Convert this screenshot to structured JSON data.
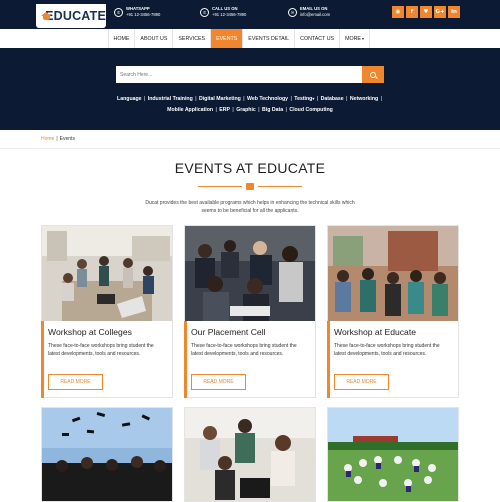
{
  "brand": {
    "name": "EDUCATE"
  },
  "contacts": [
    {
      "icon": "whatsapp-icon",
      "glyph": "✆",
      "label": "WHATSAPP",
      "value": "+91 12-3456-7890"
    },
    {
      "icon": "phone-icon",
      "glyph": "✆",
      "label": "CALL US ON",
      "value": "+91 12-3456-7890"
    },
    {
      "icon": "mail-icon",
      "glyph": "✉",
      "label": "EMAIL US ON",
      "value": "info@email.com"
    }
  ],
  "social": [
    {
      "icon": "rss-icon",
      "glyph": "◉"
    },
    {
      "icon": "facebook-icon",
      "glyph": "f"
    },
    {
      "icon": "twitter-icon",
      "glyph": "♥"
    },
    {
      "icon": "google-plus-icon",
      "glyph": "G+"
    },
    {
      "icon": "linkedin-icon",
      "glyph": "in"
    }
  ],
  "nav": {
    "items": [
      "HOME",
      "ABOUT US",
      "SERVICES",
      "EVENTS",
      "EVENTS DETAIL",
      "CONTACT US",
      "MORE"
    ],
    "active": "EVENTS",
    "more_caret": "▾"
  },
  "search": {
    "placeholder": "Search Here..."
  },
  "tags": [
    "Language",
    "Industrial Training",
    "Digital Marketing",
    "Web Technology",
    "Testing",
    "Database",
    "Networking",
    "Mobile Application",
    "ERP",
    "Graphic",
    "Big Data",
    "Cloud Computing"
  ],
  "breadcrumb": {
    "home": "Home",
    "separator": "|",
    "current": "Events"
  },
  "page": {
    "title": "EVENTS AT EDUCATE",
    "lead": "Ducat provides the best available programs which helps in enhancing the technical skills which seems to be beneficial for all the applicants."
  },
  "cards": [
    {
      "title": "Workshop at Colleges",
      "desc": "These face-to-face workshops bring student the latest developments, tools and resources.",
      "button": "READ MORE"
    },
    {
      "title": "Our Placement Cell",
      "desc": "These face-to-face workshops bring student the latest developments, tools and resources.",
      "button": "READ MORE"
    },
    {
      "title": "Workshop at Educate",
      "desc": "These face-to-face workshops bring student the latest developments, tools and resources.",
      "button": "READ MORE"
    }
  ],
  "colors": {
    "accent": "#f0862d",
    "dark": "#0c1b33"
  }
}
